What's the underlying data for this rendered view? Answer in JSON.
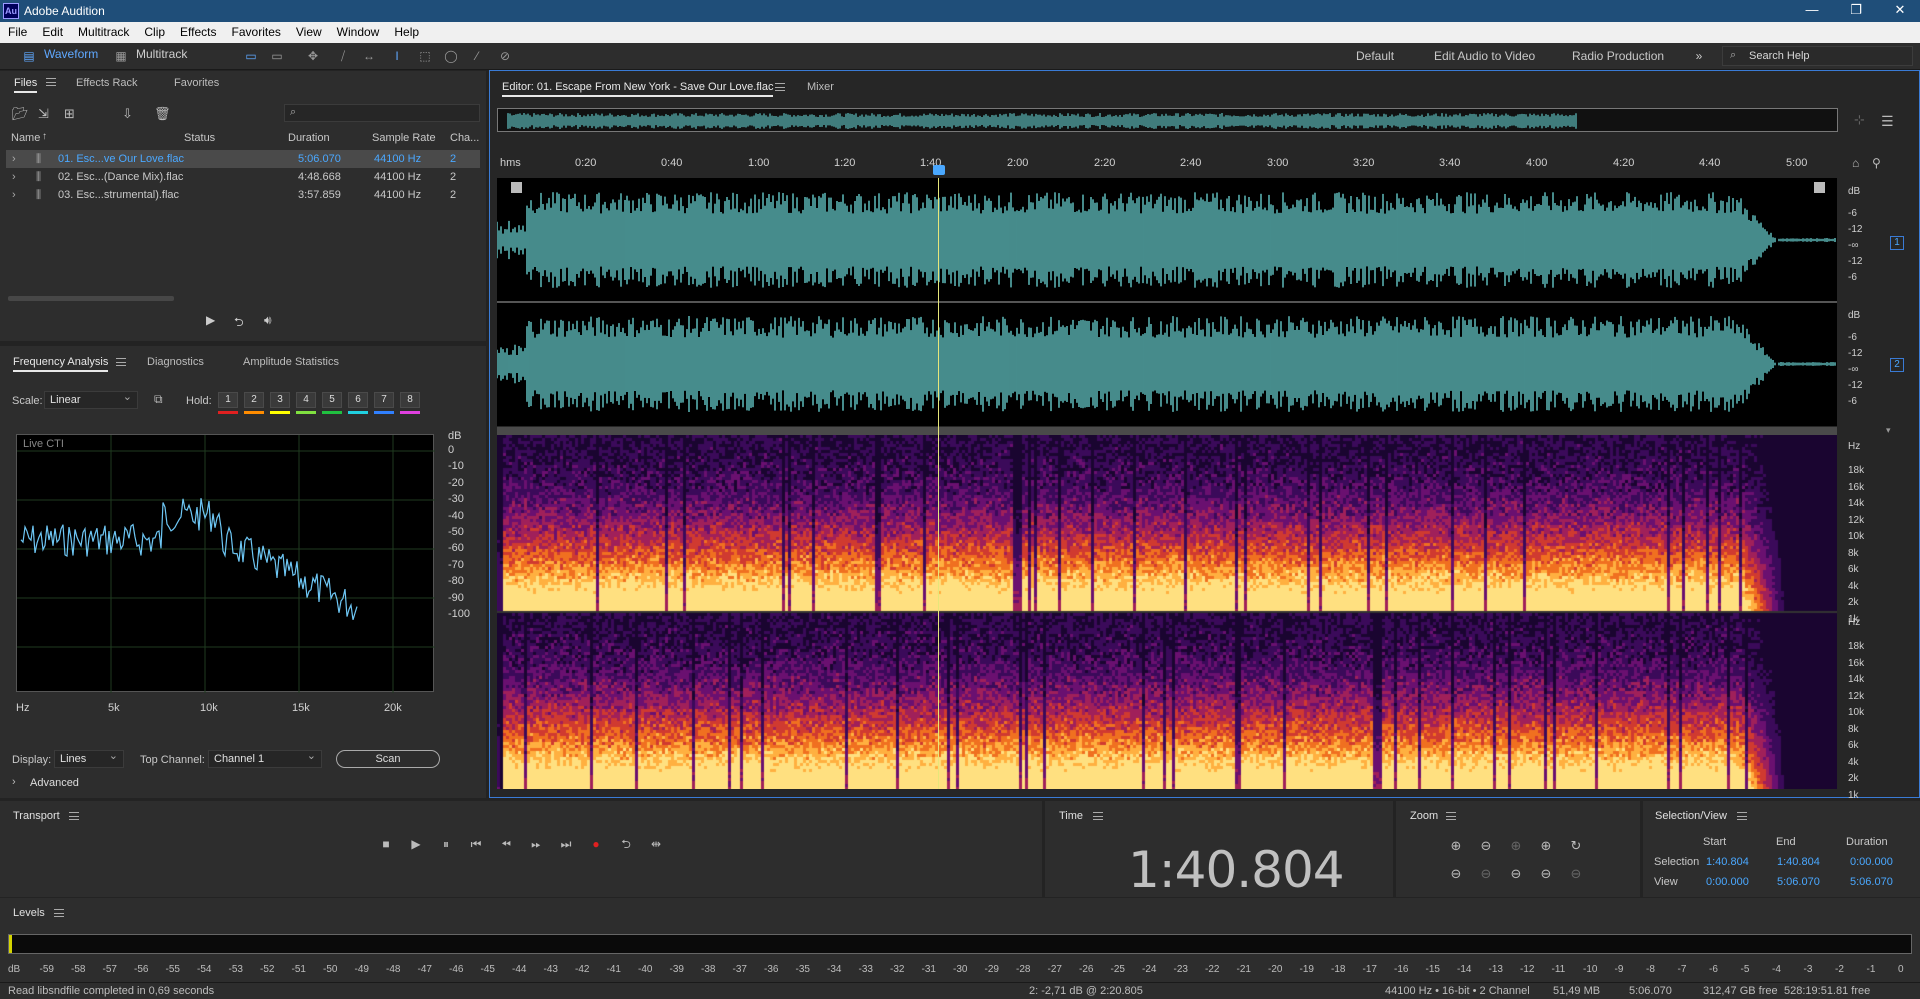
{
  "app": {
    "title": "Adobe Audition",
    "logo": "Au"
  },
  "menu": [
    "File",
    "Edit",
    "Multitrack",
    "Clip",
    "Effects",
    "Favorites",
    "View",
    "Window",
    "Help"
  ],
  "toolbar": {
    "waveform": "Waveform",
    "multitrack": "Multitrack"
  },
  "workspaces": [
    "Default",
    "Edit Audio to Video",
    "Radio Production"
  ],
  "search": {
    "placeholder": "Search Help"
  },
  "files_panel": {
    "tabs": [
      "Files",
      "Effects Rack",
      "Favorites"
    ],
    "columns": [
      "Name",
      "Status",
      "Duration",
      "Sample Rate",
      "Cha..."
    ],
    "rows": [
      {
        "name": "01. Esc...ve Our Love.flac",
        "duration": "5:06.070",
        "rate": "44100 Hz",
        "ch": "2"
      },
      {
        "name": "02. Esc...(Dance Mix).flac",
        "duration": "4:48.668",
        "rate": "44100 Hz",
        "ch": "2"
      },
      {
        "name": "03. Esc...strumental).flac",
        "duration": "3:57.859",
        "rate": "44100 Hz",
        "ch": "2"
      }
    ]
  },
  "analysis_panel": {
    "tabs": [
      "Frequency Analysis",
      "Diagnostics",
      "Amplitude Statistics"
    ],
    "scale_label": "Scale:",
    "scale_value": "Linear",
    "hold_label": "Hold:",
    "hold_buttons": [
      "1",
      "2",
      "3",
      "4",
      "5",
      "6",
      "7",
      "8"
    ],
    "hold_colors": [
      "#e02020",
      "#ff8c00",
      "#ffff00",
      "#80e040",
      "#20c040",
      "#20d0e0",
      "#3080ff",
      "#e040e0"
    ],
    "plot_title": "Live CTI",
    "db_labels": [
      "dB",
      "0",
      "-10",
      "-20",
      "-30",
      "-40",
      "-50",
      "-60",
      "-70",
      "-80",
      "-90",
      "-100"
    ],
    "hz_labels": [
      "Hz",
      "5k",
      "10k",
      "15k",
      "20k"
    ],
    "display_label": "Display:",
    "display_value": "Lines",
    "top_channel_label": "Top Channel:",
    "top_channel_value": "Channel 1",
    "scan_button": "Scan",
    "advanced": "Advanced"
  },
  "editor": {
    "tab": "Editor: 01. Escape From New York - Save Our Love.flac",
    "mixer_tab": "Mixer",
    "ruler": [
      "hms",
      "0:20",
      "0:40",
      "1:00",
      "1:20",
      "1:40",
      "2:00",
      "2:20",
      "2:40",
      "3:00",
      "3:20",
      "3:40",
      "4:00",
      "4:20",
      "4:40",
      "5:00"
    ],
    "wave_db_labels": [
      "dB",
      "-6",
      "-12",
      "-∞",
      "-12",
      "-6"
    ],
    "channel_badges": [
      "1",
      "2"
    ],
    "spec_labels": [
      "Hz",
      "18k",
      "16k",
      "14k",
      "12k",
      "10k",
      "8k",
      "6k",
      "4k",
      "2k",
      "1k"
    ]
  },
  "transport": {
    "title": "Transport"
  },
  "time": {
    "title": "Time",
    "value": "1:40.804"
  },
  "zoom": {
    "title": "Zoom"
  },
  "selection_view": {
    "title": "Selection/View",
    "headers": [
      "Start",
      "End",
      "Duration"
    ],
    "selection_label": "Selection",
    "selection": [
      "1:40.804",
      "1:40.804",
      "0:00.000"
    ],
    "view_label": "View",
    "view": [
      "0:00.000",
      "5:06.070",
      "5:06.070"
    ]
  },
  "levels": {
    "title": "Levels",
    "labels": [
      "dB",
      "-59",
      "-58",
      "-57",
      "-56",
      "-55",
      "-54",
      "-53",
      "-52",
      "-51",
      "-50",
      "-49",
      "-48",
      "-47",
      "-46",
      "-45",
      "-44",
      "-43",
      "-42",
      "-41",
      "-40",
      "-39",
      "-38",
      "-37",
      "-36",
      "-35",
      "-34",
      "-33",
      "-32",
      "-31",
      "-30",
      "-29",
      "-28",
      "-27",
      "-26",
      "-25",
      "-24",
      "-23",
      "-22",
      "-21",
      "-20",
      "-19",
      "-18",
      "-17",
      "-16",
      "-15",
      "-14",
      "-13",
      "-12",
      "-11",
      "-10",
      "-9",
      "-8",
      "-7",
      "-6",
      "-5",
      "-4",
      "-3",
      "-2",
      "-1",
      "0"
    ]
  },
  "status": {
    "left": "Read libsndfile completed in 0,69 seconds",
    "cursor": "2: -2,71 dB @ 2:20.805",
    "format": "44100 Hz • 16-bit • 2 Channel",
    "size": "51,49 MB",
    "duration": "5:06.070",
    "free": "312,47 GB free",
    "free_time": "528:19:51.81 free"
  }
}
